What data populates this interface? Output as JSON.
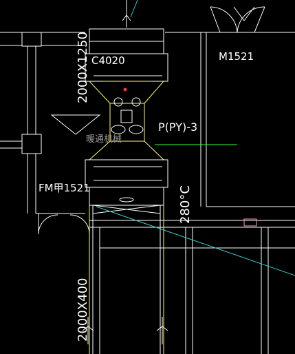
{
  "drawing": {
    "colors": {
      "background": "#000000",
      "wall": "#ffffff",
      "duct": "#ffffff",
      "accent_yellow": "#ffff66",
      "accent_green": "#33ff33",
      "accent_cyan": "#33cccc",
      "accent_red": "#ff3333"
    },
    "labels": {
      "duct_size_top": "2000X1250",
      "air_valve_tag": "C4020",
      "door_m1521": "M1521",
      "system_tag": "P(PY)-3",
      "cn_equipment_tag": "暖通机械",
      "door_fm1521": "FM甲1521",
      "fire_damper_temp": "280°C",
      "duct_size_bottom": "2000X400"
    },
    "icons": [
      "flow-arrow-icon",
      "fan-symbol-icon",
      "door-swing-icon",
      "damper-x-icon"
    ]
  }
}
